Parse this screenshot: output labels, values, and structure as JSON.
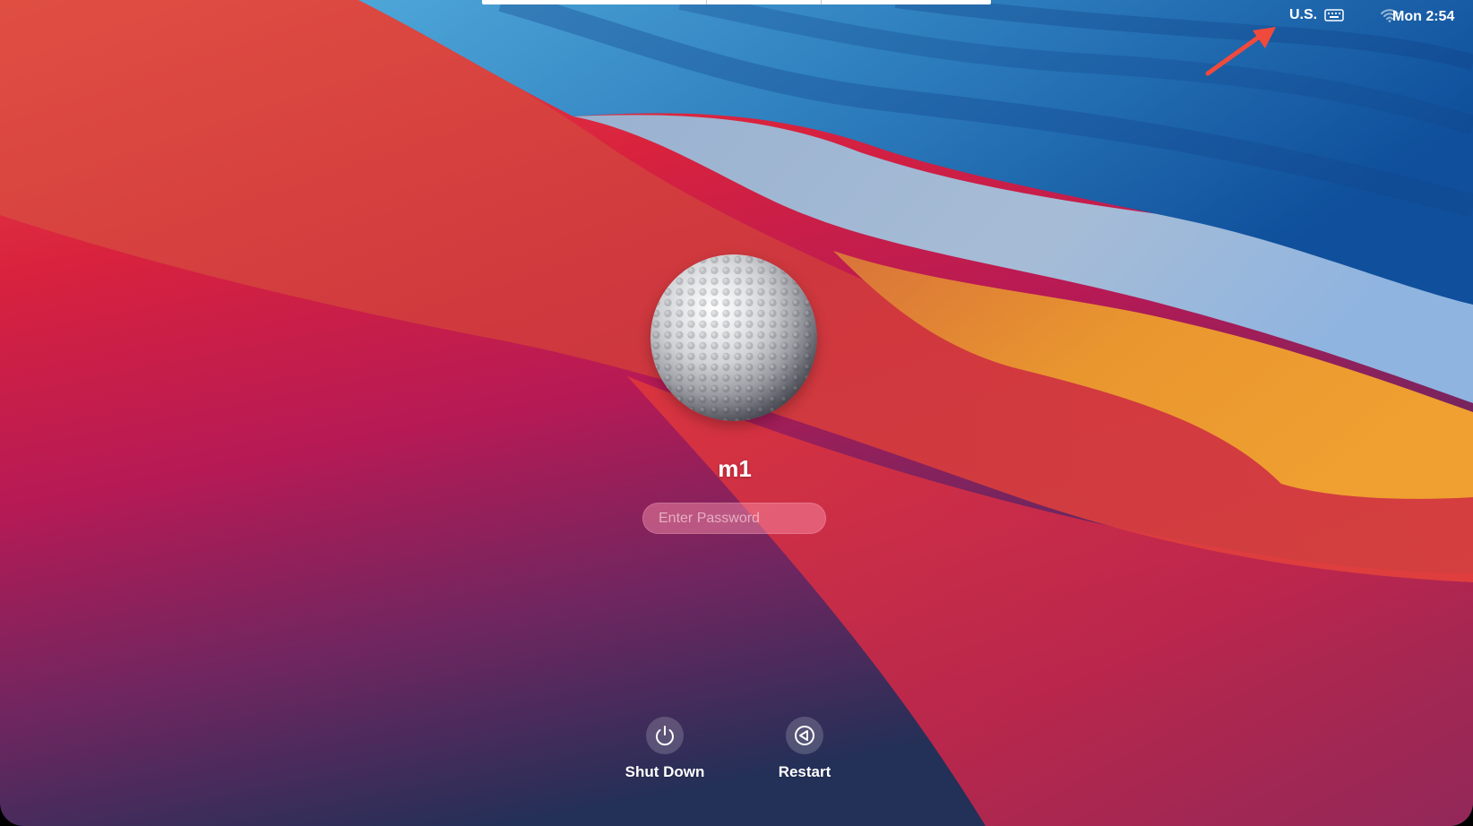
{
  "menubar": {
    "input_source": "U.S.",
    "input_source_icon": "keyboard-icon",
    "wifi_icon": "wifi-icon",
    "clock": "Mon 2:54"
  },
  "annotation": {
    "arrow_icon": "arrow-icon",
    "color": "#f04a3c"
  },
  "login": {
    "avatar_icon": "golf-ball-avatar",
    "user_name": "m1",
    "password_placeholder": "Enter Password"
  },
  "actions": {
    "shut_down": {
      "label": "Shut Down",
      "icon": "power-icon"
    },
    "restart": {
      "label": "Restart",
      "icon": "restart-icon"
    }
  }
}
